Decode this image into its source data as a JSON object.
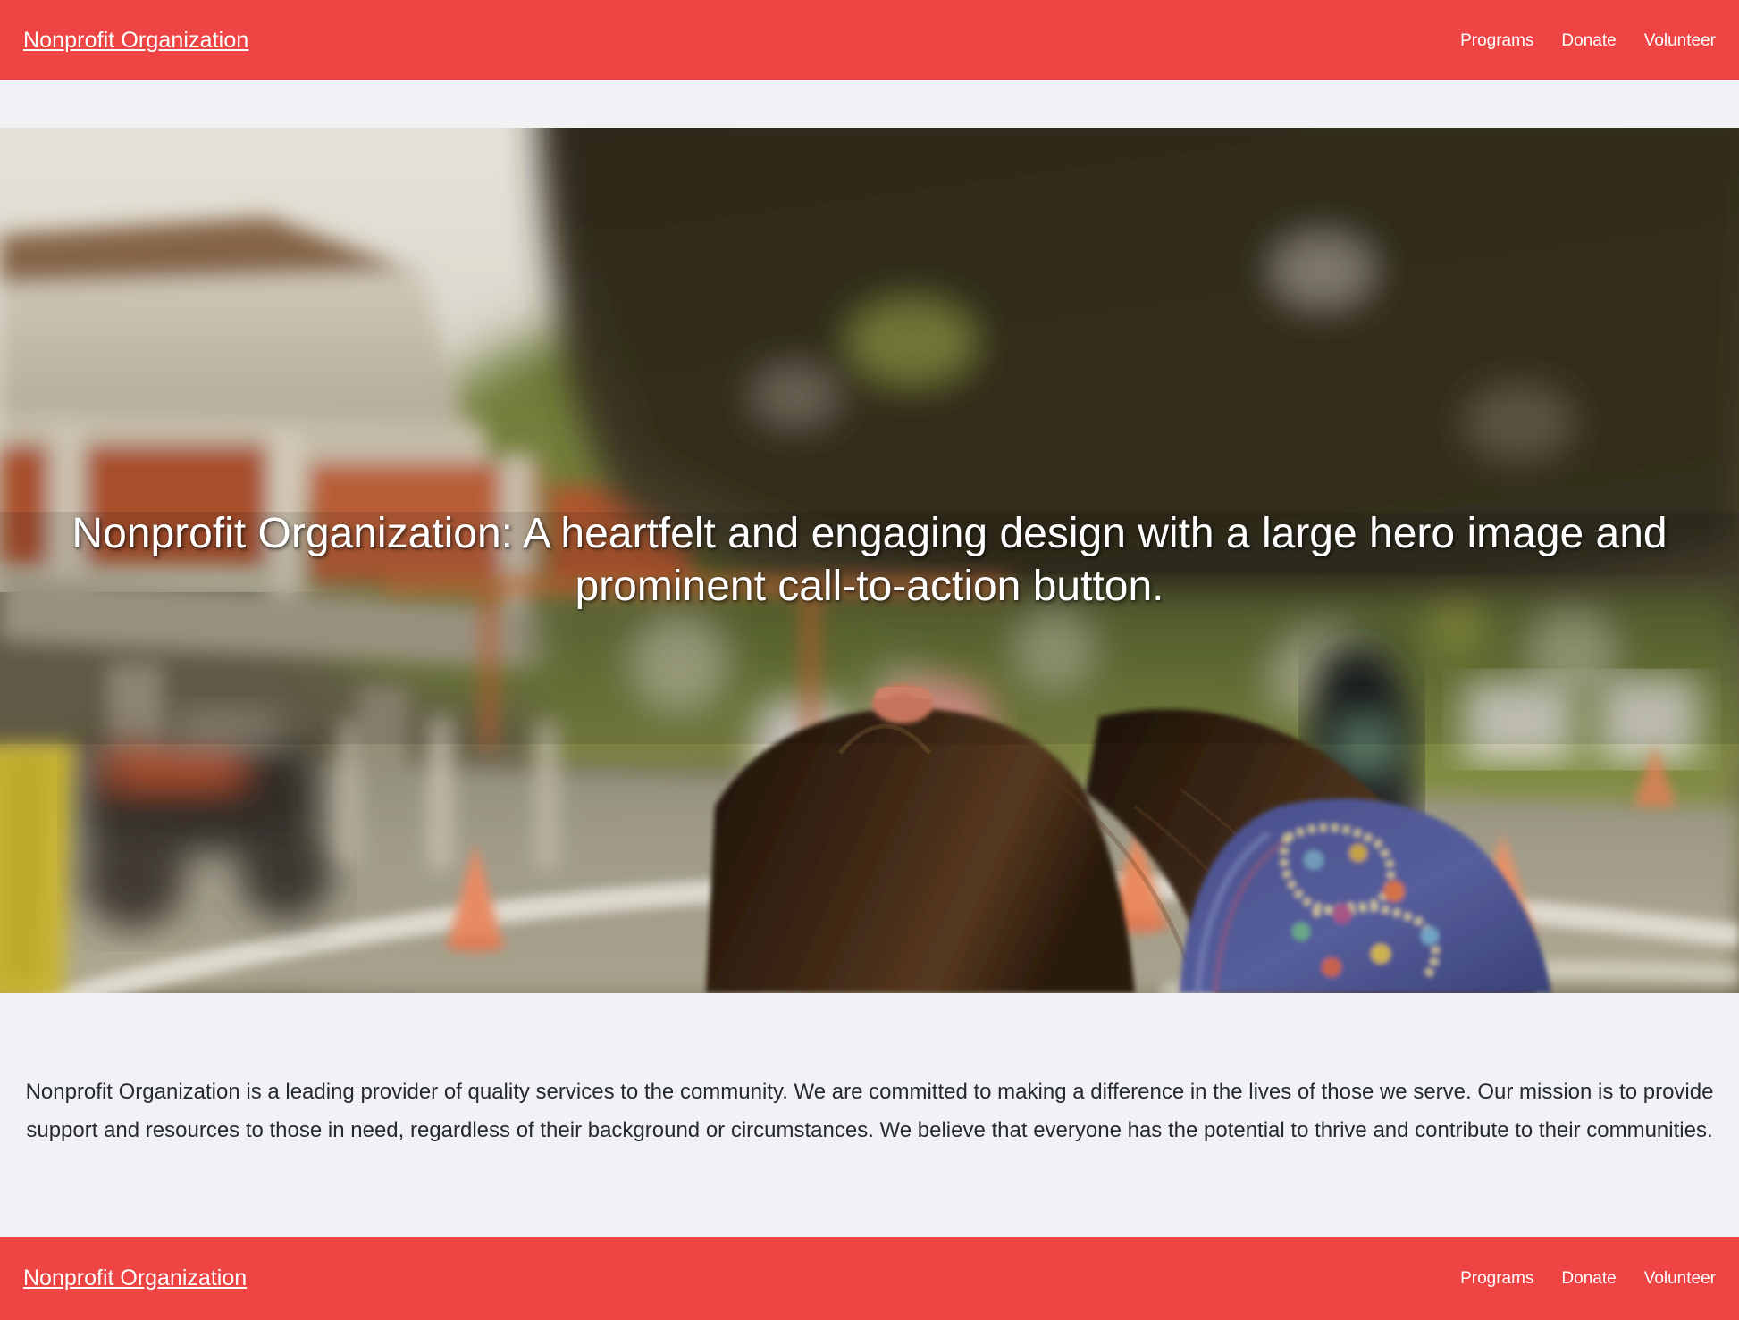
{
  "theme": {
    "brand_color": "#ef4444",
    "page_background": "#f1f2f6",
    "header_text_color": "#ffffff",
    "body_text_color": "#26292e",
    "hero_text_color": "#ffffff"
  },
  "header": {
    "brand": "Nonprofit Organization",
    "nav": [
      {
        "label": "Programs"
      },
      {
        "label": "Donate"
      },
      {
        "label": "Volunteer"
      }
    ]
  },
  "hero": {
    "headline": "Nonprofit Organization: A heartfelt and engaging design with a large hero image and prominent call-to-action button.",
    "image_alt": "Blurred outdoor playground scene: a girl with long dark hair and an embroidered blue denim jacket watches children playing near orange traffic cones on a concrete track, with a dark canopy overhead, green trees, a yellow slide and a parked motorbike in the background."
  },
  "about": {
    "paragraph": "Nonprofit Organization is a leading provider of quality services to the community. We are committed to making a difference in the lives of those we serve. Our mission is to provide support and resources to those in need, regardless of their background or circumstances. We believe that everyone has the potential to thrive and contribute to their communities."
  },
  "footer": {
    "brand": "Nonprofit Organization",
    "nav": [
      {
        "label": "Programs"
      },
      {
        "label": "Donate"
      },
      {
        "label": "Volunteer"
      }
    ]
  }
}
